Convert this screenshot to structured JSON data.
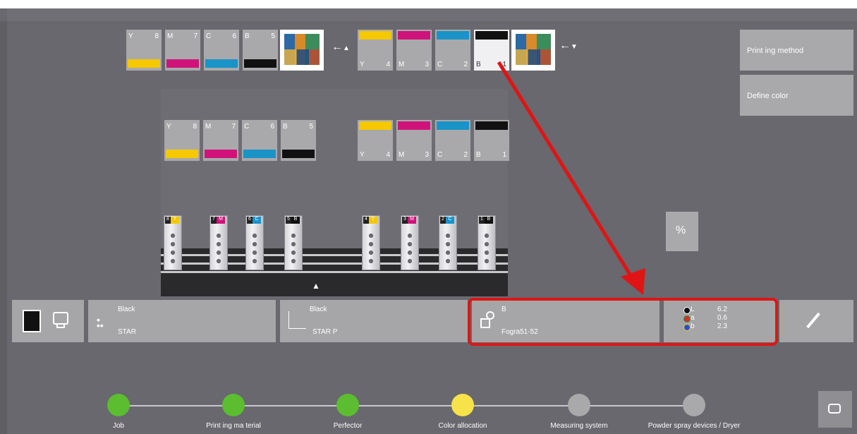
{
  "top_row_left": [
    {
      "letter": "Y",
      "num": "8",
      "color": "#f5c800"
    },
    {
      "letter": "M",
      "num": "7",
      "color": "#d0137a"
    },
    {
      "letter": "C",
      "num": "6",
      "color": "#1a93c6"
    },
    {
      "letter": "B",
      "num": "5",
      "color": "#111111"
    }
  ],
  "top_row_right": [
    {
      "letter": "Y",
      "num": "4",
      "color": "#f5c800"
    },
    {
      "letter": "M",
      "num": "3",
      "color": "#d0137a"
    },
    {
      "letter": "C",
      "num": "2",
      "color": "#1a93c6"
    },
    {
      "letter": "B",
      "num": "1",
      "color": "#111111"
    }
  ],
  "right_buttons": {
    "printing_method": "Print ing method",
    "define_color": "Define color"
  },
  "units": [
    {
      "num": "8",
      "letter": "Y",
      "color": "#f5c800"
    },
    {
      "num": "7",
      "letter": "M",
      "color": "#d0137a"
    },
    {
      "num": "6",
      "letter": "C",
      "color": "#1a93c6"
    },
    {
      "num": "5",
      "letter": "B",
      "color": "#111111"
    },
    {
      "num": "4",
      "letter": "Y",
      "color": "#f5c800"
    },
    {
      "num": "3",
      "letter": "M",
      "color": "#d0137a"
    },
    {
      "num": "2",
      "letter": "C",
      "color": "#1a93c6"
    },
    {
      "num": "1",
      "letter": "B",
      "color": "#111111"
    }
  ],
  "bottom": {
    "ink1_title": "Black",
    "ink1_sub": "STAR",
    "ink2_title": "Black",
    "ink2_sub": "STAR P",
    "profile_title": "B",
    "profile_sub": "Fogra51-52",
    "lab": {
      "L_label": "L",
      "a_label": "a",
      "b_label": "b",
      "L": "6.2",
      "a": "0.6",
      "b": "2.3"
    }
  },
  "steps": [
    {
      "label": "Job",
      "color": "#5bbd2f"
    },
    {
      "label": "Print ing ma terial",
      "color": "#5bbd2f"
    },
    {
      "label": "Perfector",
      "color": "#5bbd2f"
    },
    {
      "label": "Color allocation",
      "color": "#f7e24a"
    },
    {
      "label": "Measuring system",
      "color": "#a9a9ab"
    },
    {
      "label": "Powder spray devices / Dryer",
      "color": "#a9a9ab"
    }
  ],
  "icons": {
    "flip": "flip-arrow-icon",
    "percent": "percent-icon",
    "eyedropper": "eyedropper-icon",
    "monitor": "monitor-icon",
    "cmy": "cmy-dots-icon"
  }
}
